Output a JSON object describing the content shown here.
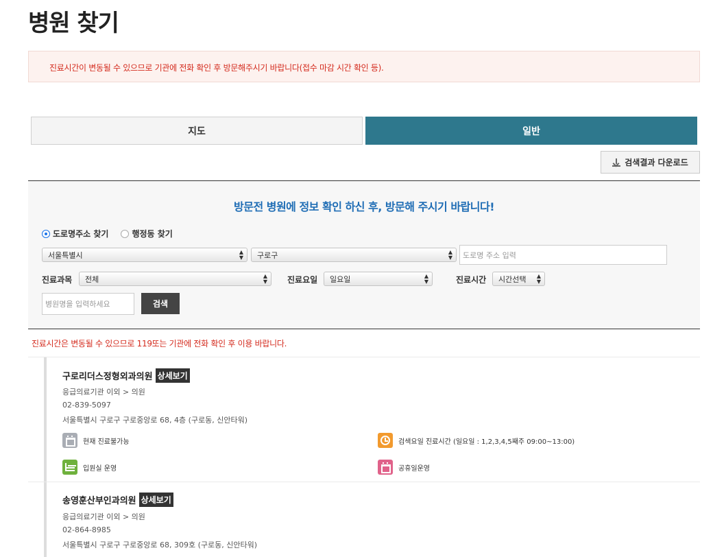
{
  "page": {
    "title": "병원 찾기"
  },
  "notice": {
    "text": "진료시간이 변동될 수 있으므로 기관에 전화 확인 후 방문해주시기 바랍니다(접수 마감 시간 확인 등)."
  },
  "tabs": [
    {
      "label": "지도",
      "active": false
    },
    {
      "label": "일반",
      "active": true
    }
  ],
  "download_button": {
    "label": "검색결과 다운로드",
    "icon": "download-icon"
  },
  "search": {
    "headline": "방문전 병원에 정보 확인 하신 후, 방문해 주시기 바랍니다!",
    "radio_road": {
      "label": "도로명주소 찾기",
      "checked": true
    },
    "radio_admin": {
      "label": "행정동 찾기",
      "checked": false
    },
    "city_select": "서울특별시",
    "district_select": "구로구",
    "road_input_placeholder": "도로명 주소 입력",
    "department_label": "진료과목",
    "department_select": "전체",
    "day_label": "진료요일",
    "day_select": "일요일",
    "time_label": "진료시간",
    "time_select": "시간선택",
    "name_input_placeholder": "병원명을 입력하세요",
    "search_button": "검색"
  },
  "warning": "진료시간은 변동될 수 있으므로 119또는 기관에 전화 확인 후 이용 바랍니다.",
  "results": [
    {
      "name": "구로리더스정형외과의원",
      "detail_label": "상세보기",
      "category": "응급의료기관 이외 > 의원",
      "phone": "02-839-5097",
      "address": "서울특별시 구로구 구로중앙로 68, 4층 (구로동, 신안타워)",
      "badges": {
        "status": "현재 진료불가능",
        "hours": "검색요일 진료시간 (일요일 : 1,2,3,4,5째주 09:00~13:00)",
        "inpatient": "입원실 운영",
        "holiday": "공휴일운영"
      }
    },
    {
      "name": "송영훈산부인과의원",
      "detail_label": "상세보기",
      "category": "응급의료기관 이외 > 의원",
      "phone": "02-864-8985",
      "address": "서울특별시 구로구 구로중앙로 68, 309호 (구로동, 신안타워)"
    }
  ],
  "colors": {
    "tab_active": "#2e788d",
    "notice_text": "#d42b1e",
    "headline": "#1f6db5",
    "badge_status": "#a9adb4",
    "badge_hours": "#f29a2e",
    "badge_inpatient": "#6fb13d",
    "badge_holiday": "#e0628a"
  }
}
